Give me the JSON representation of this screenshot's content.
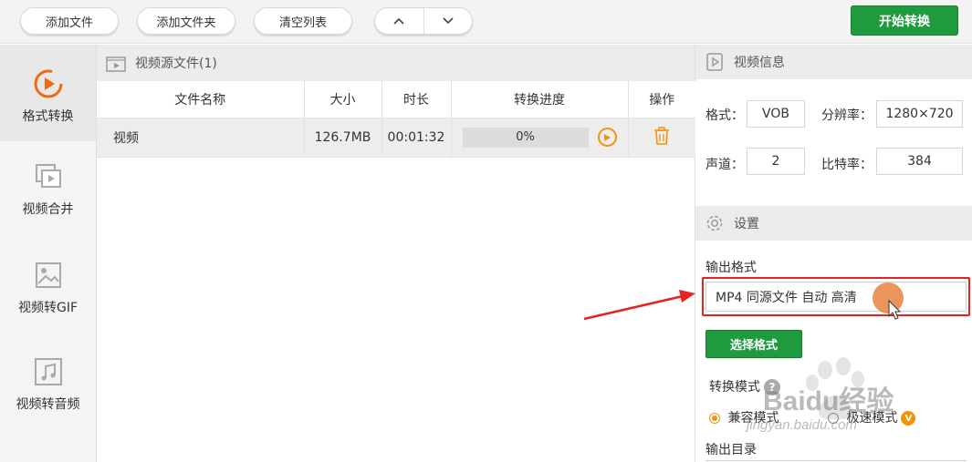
{
  "toolbar": {
    "add_file": "添加文件",
    "add_folder": "添加文件夹",
    "clear_list": "清空列表",
    "move_up_icon": "chevron-up-icon",
    "move_down_icon": "chevron-down-icon",
    "start_convert": "开始转换"
  },
  "sidebar": {
    "items": [
      {
        "label": "格式转换",
        "icon": "convert-icon",
        "active": true
      },
      {
        "label": "视频合并",
        "icon": "merge-icon",
        "active": false
      },
      {
        "label": "视频转GIF",
        "icon": "gif-icon",
        "active": false
      },
      {
        "label": "视频转音频",
        "icon": "audio-icon",
        "active": false
      }
    ]
  },
  "files": {
    "header": "视频源文件(1)",
    "columns": [
      "文件名称",
      "大小",
      "时长",
      "转换进度",
      "操作"
    ],
    "rows": [
      {
        "name": "视频",
        "size": "126.7MB",
        "duration": "00:01:32",
        "progress": "0%",
        "progress_fraction": 0
      }
    ]
  },
  "video_info": {
    "header": "视频信息",
    "format_label": "格式：",
    "format_value": "VOB",
    "resolution_label": "分辨率：",
    "resolution_value": "1280×720",
    "channels_label": "声道：",
    "channels_value": "2",
    "bitrate_label": "比特率：",
    "bitrate_value": "384"
  },
  "settings": {
    "header": "设置",
    "output_format_label": "输出格式",
    "output_format_value": "MP4 同源文件 自动 高清",
    "select_format_button": "选择格式",
    "convert_mode_label": "转换模式",
    "mode_compatible": "兼容模式",
    "mode_fast": "极速模式",
    "fast_badge": "V",
    "output_dir_label": "输出目录"
  },
  "colors": {
    "accent_green": "#1f9a3f",
    "accent_orange": "#f1940a",
    "annotation_red": "#e8201e"
  },
  "watermark": {
    "text": "Baidu经验",
    "sub": "jingyan.baidu.com"
  }
}
